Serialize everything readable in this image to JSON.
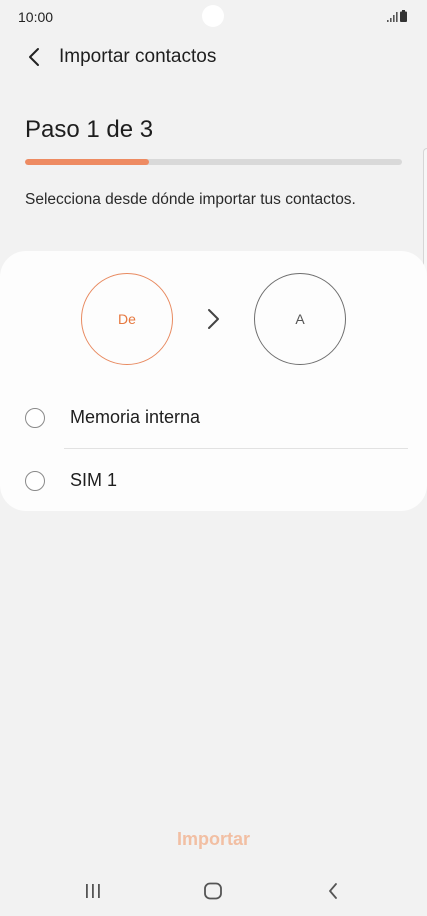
{
  "status_bar": {
    "time": "10:00",
    "icons": [
      "signal-icon",
      "battery-icon"
    ]
  },
  "header": {
    "title": "Importar contactos",
    "back_icon": "chevron-left-icon"
  },
  "step": {
    "label": "Paso 1 de 3",
    "progress": 0.33
  },
  "instruction": "Selecciona desde dónde importar tus contactos.",
  "card": {
    "from_label": "De",
    "to_label": "A",
    "arrow_icon": "chevron-right-icon",
    "options": [
      {
        "label": "Memoria interna",
        "selected": false
      },
      {
        "label": "SIM 1",
        "selected": false
      }
    ]
  },
  "footer": {
    "import_label": "Importar"
  },
  "nav": {
    "items": [
      "recents-icon",
      "home-icon",
      "back-icon"
    ]
  },
  "colors": {
    "accent": "#ee8b62",
    "accent_disabled": "#f2bfa3",
    "background": "#f2f2f2",
    "card": "#fdfdfd"
  }
}
